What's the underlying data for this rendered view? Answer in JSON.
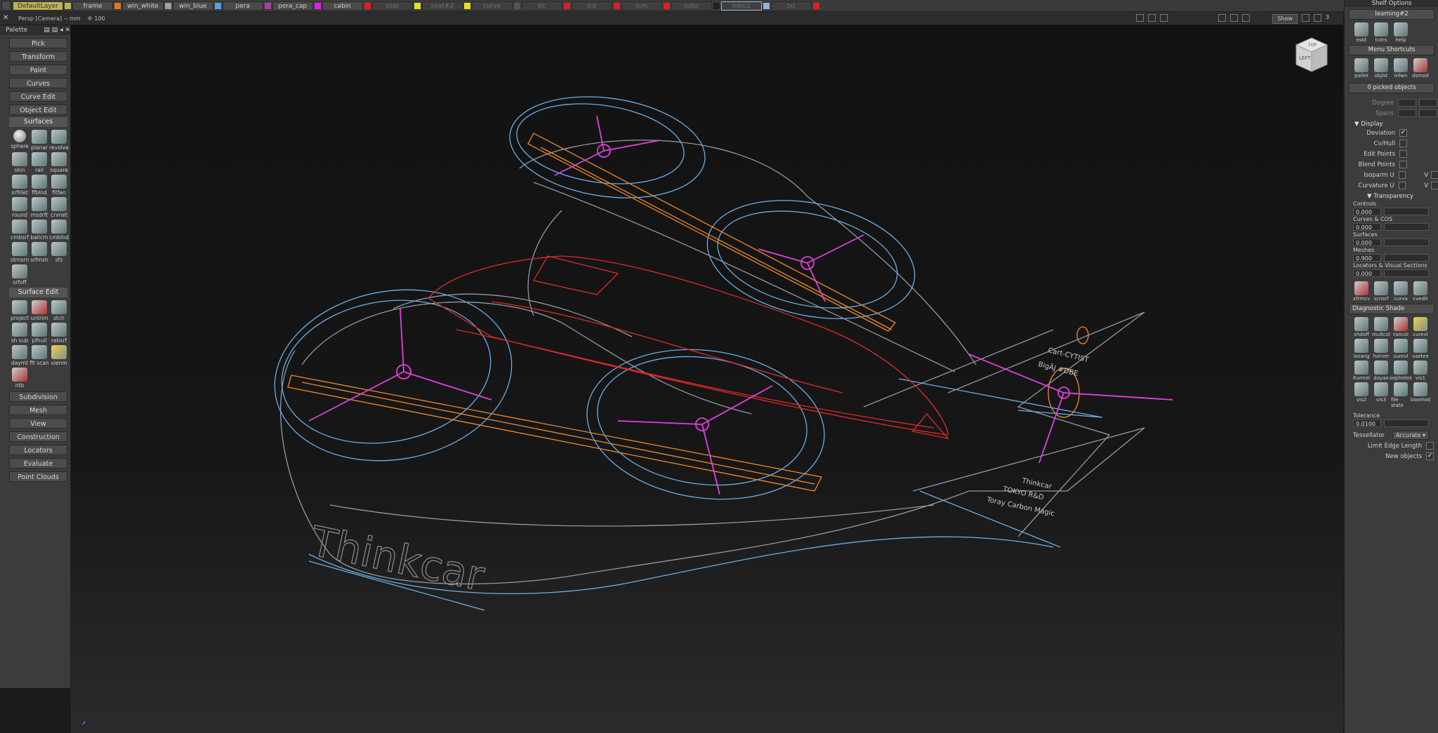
{
  "layers": [
    {
      "name": "DefaultLayer",
      "color": "#b8b45a",
      "state": "active"
    },
    {
      "name": "frame",
      "color": "#e07a1f",
      "state": "normal"
    },
    {
      "name": "win_white",
      "color": "#a0a0a0",
      "state": "normal"
    },
    {
      "name": "win_blue",
      "color": "#5aa0e6",
      "state": "normal"
    },
    {
      "name": "pera",
      "color": "#a83fa8",
      "state": "normal"
    },
    {
      "name": "pera_cap",
      "color": "#e020e0",
      "state": "normal"
    },
    {
      "name": "cabin",
      "color": "#e02020",
      "state": "normal"
    },
    {
      "name": "seat",
      "color": "#e6e020",
      "state": "dim"
    },
    {
      "name": "seat#2",
      "color": "#e6e020",
      "state": "dim"
    },
    {
      "name": "curve",
      "color": "#555555",
      "state": "dim"
    },
    {
      "name": "tfc",
      "color": "#e02020",
      "state": "dim"
    },
    {
      "name": "trd",
      "color": "#e02020",
      "state": "dim"
    },
    {
      "name": "tcm",
      "color": "#e02020",
      "state": "dim"
    },
    {
      "name": "tobo",
      "color": "#222222",
      "state": "dim"
    },
    {
      "name": "tobo2",
      "color": "#8fb3e0",
      "state": "selected"
    },
    {
      "name": "txt",
      "color": "#e02020",
      "state": "dim"
    }
  ],
  "camera": {
    "name": "Persp [Camera] -- mm",
    "zoom": "100",
    "show": "Show",
    "count": "3"
  },
  "palette": {
    "title": "Palette",
    "top_buttons": [
      "Pick",
      "Transform",
      "Paint",
      "Curves",
      "Curve Edit",
      "Object Edit"
    ],
    "surfaces_title": "Surfaces",
    "surfaces_tools": [
      "sphere",
      "planar",
      "revolve",
      "skin",
      "rail",
      "square",
      "srfillet",
      "ffblnd",
      "fitfan",
      "round",
      "msdrft",
      "crvnet",
      "cmbsrf",
      "ballcrn",
      "cmblnd",
      "strnsrn",
      "srfmsh",
      "sfs",
      "srfoff"
    ],
    "surface_edit_title": "Surface Edit",
    "surface_edit_tools": [
      "project",
      "untrim",
      "stch",
      "sh sub",
      "pfhull",
      "rebsrf",
      "daymt",
      "flt scan",
      "vienm",
      "ntb"
    ],
    "bottom_buttons": [
      "Subdivision",
      "Mesh",
      "View",
      "Construction",
      "Locators",
      "Evaluate",
      "Point Clouds"
    ]
  },
  "viewcube": {
    "top": "TOP",
    "left": "LEFT"
  },
  "shelf": {
    "title": "Shelf Options",
    "tab": "learning#2",
    "learning_tools": [
      "eskt",
      "tutrs",
      "help"
    ],
    "menu_shortcuts_title": "Menu Shortcuts",
    "menu_tools": [
      "pallet",
      "objlst",
      "infwn",
      "dsmod"
    ],
    "picked": "0 picked objects",
    "degree_label": "Degree",
    "spans_label": "Spans",
    "display_title": "Display",
    "display_options": [
      {
        "label": "Deviation",
        "checked": true
      },
      {
        "label": "Cv/Hull",
        "checked": false
      },
      {
        "label": "Edit Points",
        "checked": false
      },
      {
        "label": "Blend Points",
        "checked": false
      },
      {
        "label": "Isoparm U",
        "checked": false,
        "v": "V"
      },
      {
        "label": "Curvature U",
        "checked": false,
        "v": "V"
      }
    ],
    "transparency_title": "Transparency",
    "transparency_rows": [
      {
        "label": "Controls",
        "value": "0.000"
      },
      {
        "label": "Curves & COS",
        "value": "0.000"
      },
      {
        "label": "Surfaces",
        "value": "0.000"
      },
      {
        "label": "Meshes",
        "value": "0.900"
      },
      {
        "label": "Locators & Visual Sections",
        "value": "0.000"
      }
    ],
    "convert_tools": [
      "xfrmcv",
      "scnsrf",
      "curva",
      "cvedit"
    ],
    "diag_title": "Diagnostic Shade",
    "diag_tools": [
      "shdoff",
      "multcol",
      "rancol",
      "curevl",
      "isoang",
      "horver",
      "surevl",
      "usetex",
      "ltunnel",
      "dayao",
      "sophotes",
      "vis1",
      "vis2",
      "vis3",
      "file state",
      "boxmod"
    ],
    "tolerance_label": "Tolerance",
    "tolerance_value": "0.0100",
    "tessellator_label": "Tessellator",
    "tessellator_value": "Accurate",
    "limit_edge_label": "Limit Edge Length",
    "new_objects_label": "New objects"
  },
  "decals": {
    "brand": "Thinkcar",
    "fin_brand": "Thinkcar",
    "fin_tokyo": "TOKYO R&D",
    "fin_carbon": "Toray Carbon Magic",
    "fin_cart": "Cart-CYTIST",
    "fin_bird": "BigÄJ #DBE"
  }
}
